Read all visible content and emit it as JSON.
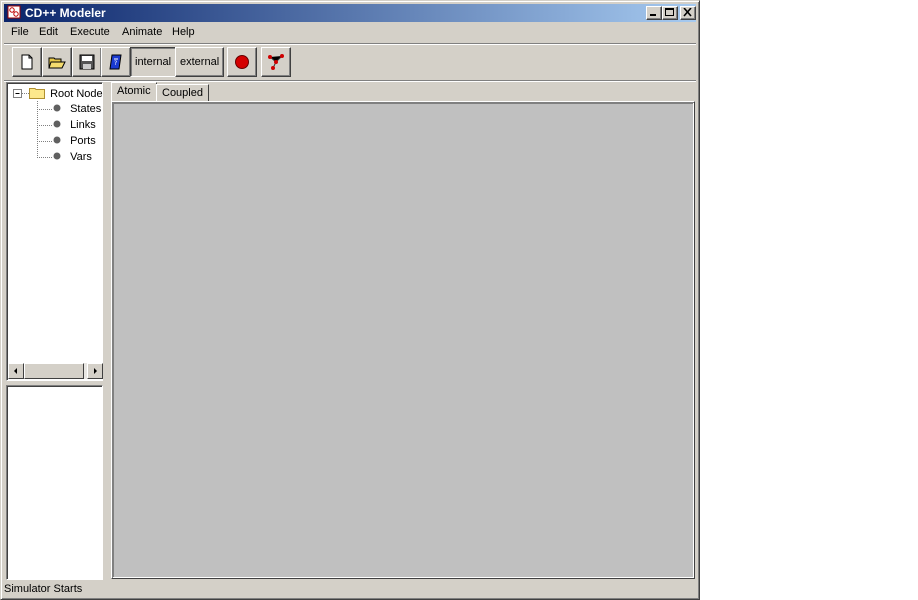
{
  "window": {
    "title": "CD++ Modeler"
  },
  "menu": {
    "items": [
      "File",
      "Edit",
      "Execute",
      "Animate",
      "Help"
    ]
  },
  "toolbar": {
    "buttons": [
      {
        "icon": "new-file-icon"
      },
      {
        "icon": "open-folder-icon"
      },
      {
        "icon": "save-disk-icon"
      },
      {
        "icon": "blue-book-icon"
      },
      {
        "label": "internal"
      },
      {
        "label": "external"
      },
      {
        "icon": "red-circle-icon"
      },
      {
        "icon": "link-graph-icon"
      }
    ]
  },
  "tree": {
    "root": "Root Node",
    "children": [
      "States",
      "Links",
      "Ports",
      "Vars"
    ]
  },
  "tabs": [
    "Atomic",
    "Coupled"
  ],
  "status": {
    "text": "Simulator Starts"
  },
  "colors": {
    "titlebar_start": "#0a246a",
    "titlebar_end": "#a6caf0",
    "canvas": "#c0c0c0",
    "face": "#d4d0c8"
  }
}
